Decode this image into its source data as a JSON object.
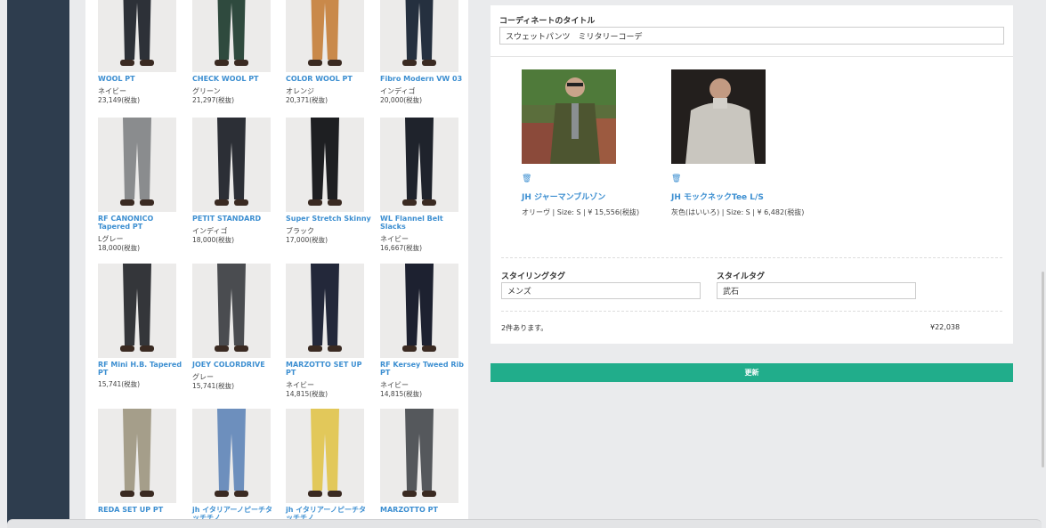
{
  "products": [
    {
      "name": "WOOL PT",
      "color": "ネイビー",
      "price": "23,149(税抜)",
      "swatch": "#2d3138"
    },
    {
      "name": "CHECK WOOL PT",
      "color": "グリーン",
      "price": "21,297(税抜)",
      "swatch": "#2f4a3e"
    },
    {
      "name": "COLOR WOOL PT",
      "color": "オレンジ",
      "price": "20,371(税抜)",
      "swatch": "#c9894a"
    },
    {
      "name": "Fibro Modern VW 03",
      "color": "インディゴ",
      "price": "20,000(税抜)",
      "swatch": "#25303f"
    },
    {
      "name": "RF CANONICO Tapered PT",
      "color": "Lグレー",
      "price": "18,000(税抜)",
      "swatch": "#8a8c8e"
    },
    {
      "name": "PETIT STANDARD",
      "color": "インディゴ",
      "price": "18,000(税抜)",
      "swatch": "#2c2f36"
    },
    {
      "name": "Super Stretch Skinny",
      "color": "ブラック",
      "price": "17,000(税抜)",
      "swatch": "#1e1f22"
    },
    {
      "name": "WL Flannel Belt Slacks",
      "color": "ネイビー",
      "price": "16,667(税抜)",
      "swatch": "#1f232c"
    },
    {
      "name": "RF Mini H.B. Tapered PT",
      "color": "",
      "price": "15,741(税抜)",
      "swatch": "#34363a"
    },
    {
      "name": "JOEY COLORDRIVE",
      "color": "グレー",
      "price": "15,741(税抜)",
      "swatch": "#4a4c50"
    },
    {
      "name": "MARZOTTO SET UP PT",
      "color": "ネイビー",
      "price": "14,815(税抜)",
      "swatch": "#23283a"
    },
    {
      "name": "RF Kersey Tweed Rib PT",
      "color": "ネイビー",
      "price": "14,815(税抜)",
      "swatch": "#1d2130"
    },
    {
      "name": "REDA SET UP PT",
      "color": "",
      "price": "",
      "swatch": "#a59e8a"
    },
    {
      "name": "jh イタリアーノピーチタッチチノ",
      "color": "",
      "price": "",
      "swatch": "#6d8fbd"
    },
    {
      "name": "jh イタリアーノピーチタッチチノ",
      "color": "",
      "price": "",
      "swatch": "#e2c85a"
    },
    {
      "name": "MARZOTTO PT",
      "color": "",
      "price": "",
      "swatch": "#55585c"
    }
  ],
  "coordinate": {
    "title_label": "コーディネートのタイトル",
    "title_value": "スウェットパンツ　ミリタリーコーデ",
    "items": [
      {
        "name": "JH ジャーマンブルゾン",
        "detail": "オリーヴ | Size: S | ¥ 15,556(税抜)",
        "trash_icon": "🗑"
      },
      {
        "name": "JH モックネックTee L/S",
        "detail": "灰色(はいいろ) | Size: S | ¥ 6,482(税抜)",
        "trash_icon": "🗑"
      }
    ],
    "styling_tag_label": "スタイリングタグ",
    "styling_tag_value": "メンズ",
    "style_tag_label": "スタイルタグ",
    "style_tag_value": "武石",
    "count_text": "2件あります。",
    "total": "¥22,038",
    "update_label": "更新"
  },
  "colors": {
    "sidebar": "#2e3d4e",
    "accent": "#21ad8b",
    "link": "#3d8fd1"
  }
}
